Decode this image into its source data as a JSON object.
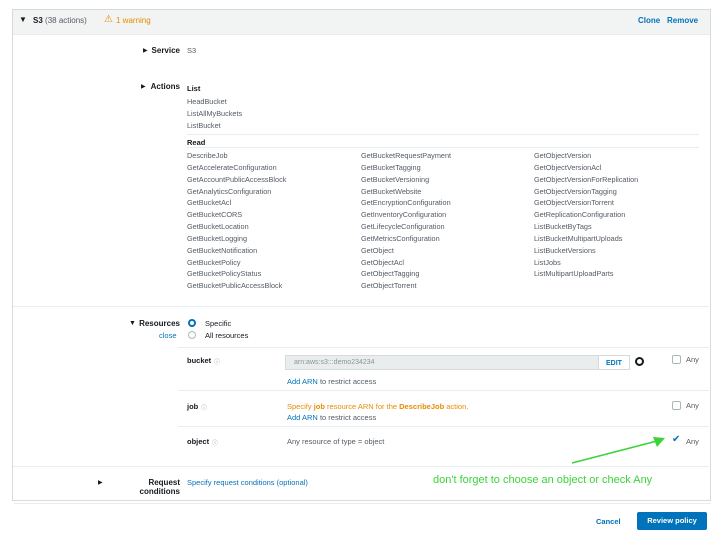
{
  "header": {
    "service_label": "S3",
    "action_count": "(38 actions)",
    "warning_text": "1 warning",
    "clone_label": "Clone",
    "remove_label": "Remove"
  },
  "service": {
    "label": "Service",
    "value": "S3"
  },
  "actions": {
    "label": "Actions",
    "list_heading": "List",
    "list_items": [
      "HeadBucket",
      "ListAllMyBuckets",
      "ListBucket"
    ],
    "read_heading": "Read",
    "read_col1": [
      "DescribeJob",
      "GetAccelerateConfiguration",
      "GetAccountPublicAccessBlock",
      "GetAnalyticsConfiguration",
      "GetBucketAcl",
      "GetBucketCORS",
      "GetBucketLocation",
      "GetBucketLogging",
      "GetBucketNotification",
      "GetBucketPolicy",
      "GetBucketPolicyStatus",
      "GetBucketPublicAccessBlock"
    ],
    "read_col2": [
      "GetBucketRequestPayment",
      "GetBucketTagging",
      "GetBucketVersioning",
      "GetBucketWebsite",
      "GetEncryptionConfiguration",
      "GetInventoryConfiguration",
      "GetLifecycleConfiguration",
      "GetMetricsConfiguration",
      "GetObject",
      "GetObjectAcl",
      "GetObjectTagging",
      "GetObjectTorrent"
    ],
    "read_col3": [
      "GetObjectVersion",
      "GetObjectVersionAcl",
      "GetObjectVersionForReplication",
      "GetObjectVersionTagging",
      "GetObjectVersionTorrent",
      "GetReplicationConfiguration",
      "ListBucketByTags",
      "ListBucketMultipartUploads",
      "ListBucketVersions",
      "ListJobs",
      "ListMultipartUploadParts"
    ]
  },
  "resources": {
    "label": "Resources",
    "close_label": "close",
    "specific_label": "Specific",
    "all_label": "All resources",
    "bucket": {
      "label": "bucket",
      "arn_value": "arn:aws:s3:::demo234234",
      "edit_label": "EDIT",
      "any_label": "Any",
      "add_arn_link": "Add ARN",
      "add_arn_suffix": " to restrict access"
    },
    "job": {
      "label": "job",
      "warn_prefix": "Specify ",
      "warn_bold": "job",
      "warn_mid": " resource ARN for the ",
      "warn_action": "DescribeJob",
      "warn_suffix": " action.",
      "add_arn_link": "Add ARN",
      "add_arn_suffix": " to restrict access",
      "any_label": "Any"
    },
    "object": {
      "label": "object",
      "description": "Any resource of type = object",
      "any_label": "Any"
    }
  },
  "request_conditions": {
    "label": "Request conditions",
    "link": "Specify request conditions (optional)"
  },
  "annotation": "don't forget to choose an object or check Any",
  "footer": {
    "cancel_label": "Cancel",
    "review_label": "Review policy"
  },
  "colors": {
    "link": "#0073bb",
    "warning": "#e88b00",
    "annotation": "#3bd33b",
    "primary": "#0073bb"
  }
}
